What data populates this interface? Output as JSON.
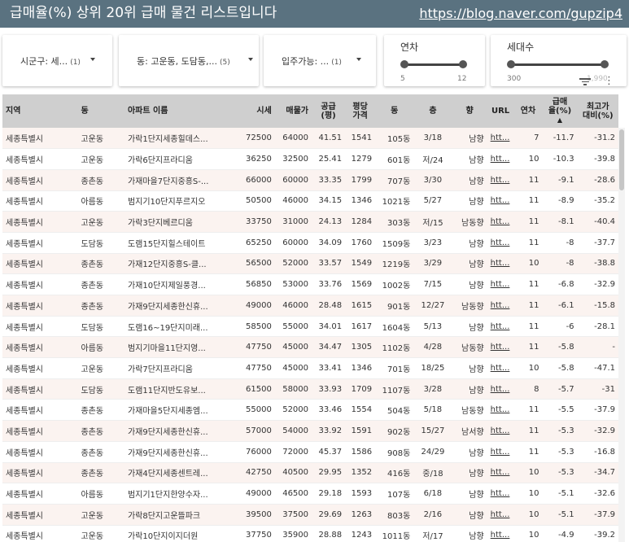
{
  "header": {
    "title": "급매율(%) 상위 20위 급매 물건 리스트입니다",
    "link": "https://blog.naver.com/gupzip4",
    "bg_color": "#5a7280"
  },
  "filters": {
    "sigungu": {
      "label": "시군구: 세...",
      "count": "(1)"
    },
    "dong": {
      "label": "동: 고운동, 도담동,...",
      "count": "(5)"
    },
    "movein": {
      "label": "입주가능: ...",
      "count": "(1)"
    },
    "year": {
      "label": "연차",
      "min": "5",
      "max": "12"
    },
    "households": {
      "label": "세대수",
      "min": "300",
      "max": "1,990"
    }
  },
  "toolbar": {
    "filter_icon": "filter-icon",
    "more_icon": "more-vert-icon"
  },
  "table": {
    "headers": [
      "지역",
      "동",
      "아파트 이름",
      "시세",
      "매물가",
      "공급\n(평)",
      "평당\n가격",
      "동",
      "층",
      "향",
      "URL",
      "연차",
      "급매\n율(%)",
      "최고가\n대비(%)"
    ],
    "sorted_column": "급매율(%)",
    "rows": [
      [
        "세종특별시",
        "고운동",
        "가락1단지세종힐데스...",
        "72500",
        "64000",
        "41.51",
        "1541",
        "105동",
        "3/18",
        "남향",
        "htt...",
        "7",
        "-11.7",
        "-31.2"
      ],
      [
        "세종특별시",
        "고운동",
        "가락6단지프라디움",
        "36250",
        "32500",
        "25.41",
        "1279",
        "601동",
        "저/24",
        "남향",
        "htt...",
        "10",
        "-10.3",
        "-39.8"
      ],
      [
        "세종특별시",
        "종촌동",
        "가재마을7단지중흥S-...",
        "66000",
        "60000",
        "33.35",
        "1799",
        "707동",
        "3/30",
        "남향",
        "htt...",
        "11",
        "-9.1",
        "-28.6"
      ],
      [
        "세종특별시",
        "아름동",
        "범지기10단지푸르지오",
        "50500",
        "46000",
        "34.15",
        "1346",
        "1021동",
        "5/27",
        "남향",
        "htt...",
        "11",
        "-8.9",
        "-35.2"
      ],
      [
        "세종특별시",
        "고운동",
        "가락3단지베르디움",
        "33750",
        "31000",
        "24.13",
        "1284",
        "303동",
        "저/15",
        "남동향",
        "htt...",
        "11",
        "-8.1",
        "-40.4"
      ],
      [
        "세종특별시",
        "도담동",
        "도램15단지힐스테이트",
        "65250",
        "60000",
        "34.09",
        "1760",
        "1509동",
        "3/23",
        "남향",
        "htt...",
        "11",
        "-8",
        "-37.7"
      ],
      [
        "세종특별시",
        "종촌동",
        "가재12단지중흥S-클...",
        "56500",
        "52000",
        "33.57",
        "1549",
        "1219동",
        "3/29",
        "남향",
        "htt...",
        "10",
        "-8",
        "-38.8"
      ],
      [
        "세종특별시",
        "종촌동",
        "가재10단지제일풍경...",
        "56850",
        "53000",
        "33.76",
        "1569",
        "1002동",
        "7/15",
        "남향",
        "htt...",
        "11",
        "-6.8",
        "-32.9"
      ],
      [
        "세종특별시",
        "종촌동",
        "가재9단지세종한신휴...",
        "49000",
        "46000",
        "28.48",
        "1615",
        "901동",
        "12/27",
        "남동향",
        "htt...",
        "11",
        "-6.1",
        "-15.8"
      ],
      [
        "세종특별시",
        "도담동",
        "도램16~19단지미래...",
        "58500",
        "55000",
        "34.01",
        "1617",
        "1604동",
        "5/13",
        "남향",
        "htt...",
        "11",
        "-6",
        "-28.1"
      ],
      [
        "세종특별시",
        "아름동",
        "범지기마을11단지영...",
        "47750",
        "45000",
        "34.47",
        "1305",
        "1102동",
        "4/28",
        "남동향",
        "htt...",
        "11",
        "-5.8",
        "-"
      ],
      [
        "세종특별시",
        "고운동",
        "가락7단지프라디움",
        "47750",
        "45000",
        "33.41",
        "1346",
        "701동",
        "18/25",
        "남향",
        "htt...",
        "10",
        "-5.8",
        "-47.1"
      ],
      [
        "세종특별시",
        "도담동",
        "도램11단지반도유보...",
        "61500",
        "58000",
        "33.93",
        "1709",
        "1107동",
        "3/28",
        "남향",
        "htt...",
        "8",
        "-5.7",
        "-31"
      ],
      [
        "세종특별시",
        "종촌동",
        "가재마을5단지세종엠...",
        "55000",
        "52000",
        "33.46",
        "1554",
        "504동",
        "5/18",
        "남동향",
        "htt...",
        "11",
        "-5.5",
        "-37.9"
      ],
      [
        "세종특별시",
        "종촌동",
        "가재9단지세종한신휴...",
        "57000",
        "54000",
        "33.92",
        "1591",
        "902동",
        "15/27",
        "남서향",
        "htt...",
        "11",
        "-5.3",
        "-32.9"
      ],
      [
        "세종특별시",
        "종촌동",
        "가재9단지세종한신휴...",
        "76000",
        "72000",
        "45.37",
        "1586",
        "908동",
        "24/29",
        "남향",
        "htt...",
        "11",
        "-5.3",
        "-16.8"
      ],
      [
        "세종특별시",
        "종촌동",
        "가재4단지세종센트레...",
        "42750",
        "40500",
        "29.95",
        "1352",
        "416동",
        "중/18",
        "남향",
        "htt...",
        "10",
        "-5.3",
        "-34.7"
      ],
      [
        "세종특별시",
        "아름동",
        "범지기1단지한양수자...",
        "49000",
        "46500",
        "29.18",
        "1593",
        "107동",
        "6/18",
        "남향",
        "htt...",
        "10",
        "-5.1",
        "-32.6"
      ],
      [
        "세종특별시",
        "고운동",
        "가락8단지고운뜰파크",
        "39500",
        "37500",
        "29.69",
        "1263",
        "803동",
        "2/16",
        "남향",
        "htt...",
        "10",
        "-5.1",
        "-37.9"
      ],
      [
        "세종특별시",
        "고운동",
        "가락10단지이지더원",
        "37750",
        "35900",
        "28.88",
        "1243",
        "1011동",
        "저/17",
        "남향",
        "htt...",
        "10",
        "-4.9",
        "-39.2"
      ]
    ]
  }
}
